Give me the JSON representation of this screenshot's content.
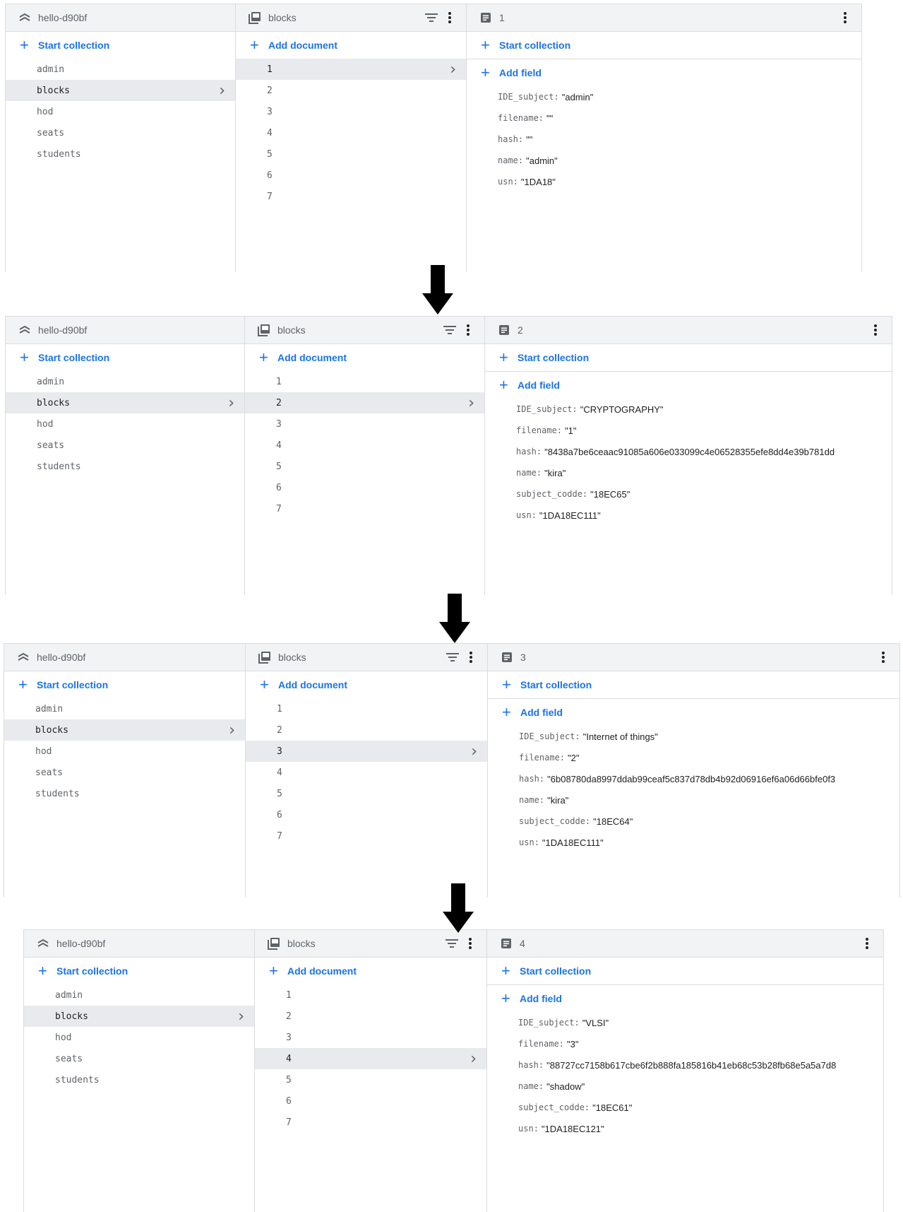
{
  "panels": [
    {
      "project": "hello-d90bf",
      "root": {
        "action": "Start collection",
        "items": [
          "admin",
          "blocks",
          "hod",
          "seats",
          "students"
        ],
        "selected": 1
      },
      "collection": {
        "title": "blocks",
        "action": "Add document",
        "items": [
          "1",
          "2",
          "3",
          "4",
          "5",
          "6",
          "7"
        ],
        "selected": 0
      },
      "document": {
        "title": "1",
        "start_collection": "Start collection",
        "add_field": "Add field",
        "fields": [
          {
            "key": "IDE_subject",
            "value": "\"admin\""
          },
          {
            "key": "filename",
            "value": "\"\""
          },
          {
            "key": "hash",
            "value": "\"\""
          },
          {
            "key": "name",
            "value": "\"admin\""
          },
          {
            "key": "usn",
            "value": "\"1DA18\""
          }
        ]
      }
    },
    {
      "project": "hello-d90bf",
      "root": {
        "action": "Start collection",
        "items": [
          "admin",
          "blocks",
          "hod",
          "seats",
          "students"
        ],
        "selected": 1
      },
      "collection": {
        "title": "blocks",
        "action": "Add document",
        "items": [
          "1",
          "2",
          "3",
          "4",
          "5",
          "6",
          "7"
        ],
        "selected": 1
      },
      "document": {
        "title": "2",
        "start_collection": "Start collection",
        "add_field": "Add field",
        "fields": [
          {
            "key": "IDE_subject",
            "value": "\"CRYPTOGRAPHY\""
          },
          {
            "key": "filename",
            "value": "\"1\""
          },
          {
            "key": "hash",
            "value": "\"8438a7be6ceaac91085a606e033099c4e06528355efe8dd4e39b781dd"
          },
          {
            "key": "name",
            "value": "\"kira\""
          },
          {
            "key": "subject_codde",
            "value": "\"18EC65\""
          },
          {
            "key": "usn",
            "value": "\"1DA18EC111\""
          }
        ]
      }
    },
    {
      "project": "hello-d90bf",
      "root": {
        "action": "Start collection",
        "items": [
          "admin",
          "blocks",
          "hod",
          "seats",
          "students"
        ],
        "selected": 1
      },
      "collection": {
        "title": "blocks",
        "action": "Add document",
        "items": [
          "1",
          "2",
          "3",
          "4",
          "5",
          "6",
          "7"
        ],
        "selected": 2
      },
      "document": {
        "title": "3",
        "start_collection": "Start collection",
        "add_field": "Add field",
        "fields": [
          {
            "key": "IDE_subject",
            "value": "\"Internet of things\""
          },
          {
            "key": "filename",
            "value": "\"2\""
          },
          {
            "key": "hash",
            "value": "\"6b08780da8997ddab99ceaf5c837d78db4b92d06916ef6a06d66bfe0f3"
          },
          {
            "key": "name",
            "value": "\"kira\""
          },
          {
            "key": "subject_codde",
            "value": "\"18EC64\""
          },
          {
            "key": "usn",
            "value": "\"1DA18EC111\""
          }
        ]
      }
    },
    {
      "project": "hello-d90bf",
      "root": {
        "action": "Start collection",
        "items": [
          "admin",
          "blocks",
          "hod",
          "seats",
          "students"
        ],
        "selected": 1
      },
      "collection": {
        "title": "blocks",
        "action": "Add document",
        "items": [
          "1",
          "2",
          "3",
          "4",
          "5",
          "6",
          "7"
        ],
        "selected": 3
      },
      "document": {
        "title": "4",
        "start_collection": "Start collection",
        "add_field": "Add field",
        "fields": [
          {
            "key": "IDE_subject",
            "value": "\"VLSI\""
          },
          {
            "key": "filename",
            "value": "\"3\""
          },
          {
            "key": "hash",
            "value": "\"88727cc7158b617cbe6f2b888fa185816b41eb68c53b28fb68e5a5a7d8"
          },
          {
            "key": "name",
            "value": "\"shadow\""
          },
          {
            "key": "subject_codde",
            "value": "\"18EC61\""
          },
          {
            "key": "usn",
            "value": "\"1DA18EC121\""
          }
        ]
      }
    }
  ],
  "icons": {
    "project": "firebase-project-icon",
    "collection": "collection-icon",
    "document": "document-icon",
    "filter": "filter-icon",
    "more": "more-vert-icon",
    "arrow": "down-arrow-icon"
  },
  "colors": {
    "accent": "#1a73e8",
    "header_bg": "#f1f3f4",
    "selected_bg": "#e8eaed",
    "border": "#dadce0"
  }
}
